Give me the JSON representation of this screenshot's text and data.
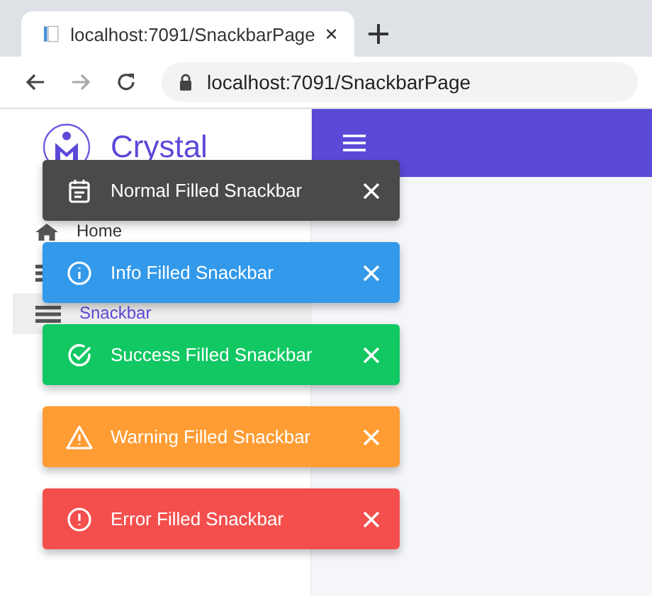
{
  "browser": {
    "tab_title": "localhost:7091/SnackbarPage",
    "url": "localhost:7091/SnackbarPage"
  },
  "sidebar": {
    "brand": "Crystal",
    "items": [
      {
        "kind": "home",
        "label": "Home",
        "selected": false
      },
      {
        "kind": "list",
        "selected": false
      },
      {
        "kind": "list",
        "label": "Snackbar",
        "selected": true
      }
    ]
  },
  "snackbars": [
    {
      "kind": "normal",
      "message": "Normal Filled Snackbar"
    },
    {
      "kind": "info",
      "message": "Info Filled Snackbar"
    },
    {
      "kind": "success",
      "message": "Success Filled Snackbar"
    },
    {
      "kind": "warning",
      "message": "Warning Filled Snackbar"
    },
    {
      "kind": "error",
      "message": "Error Filled Snackbar"
    }
  ]
}
